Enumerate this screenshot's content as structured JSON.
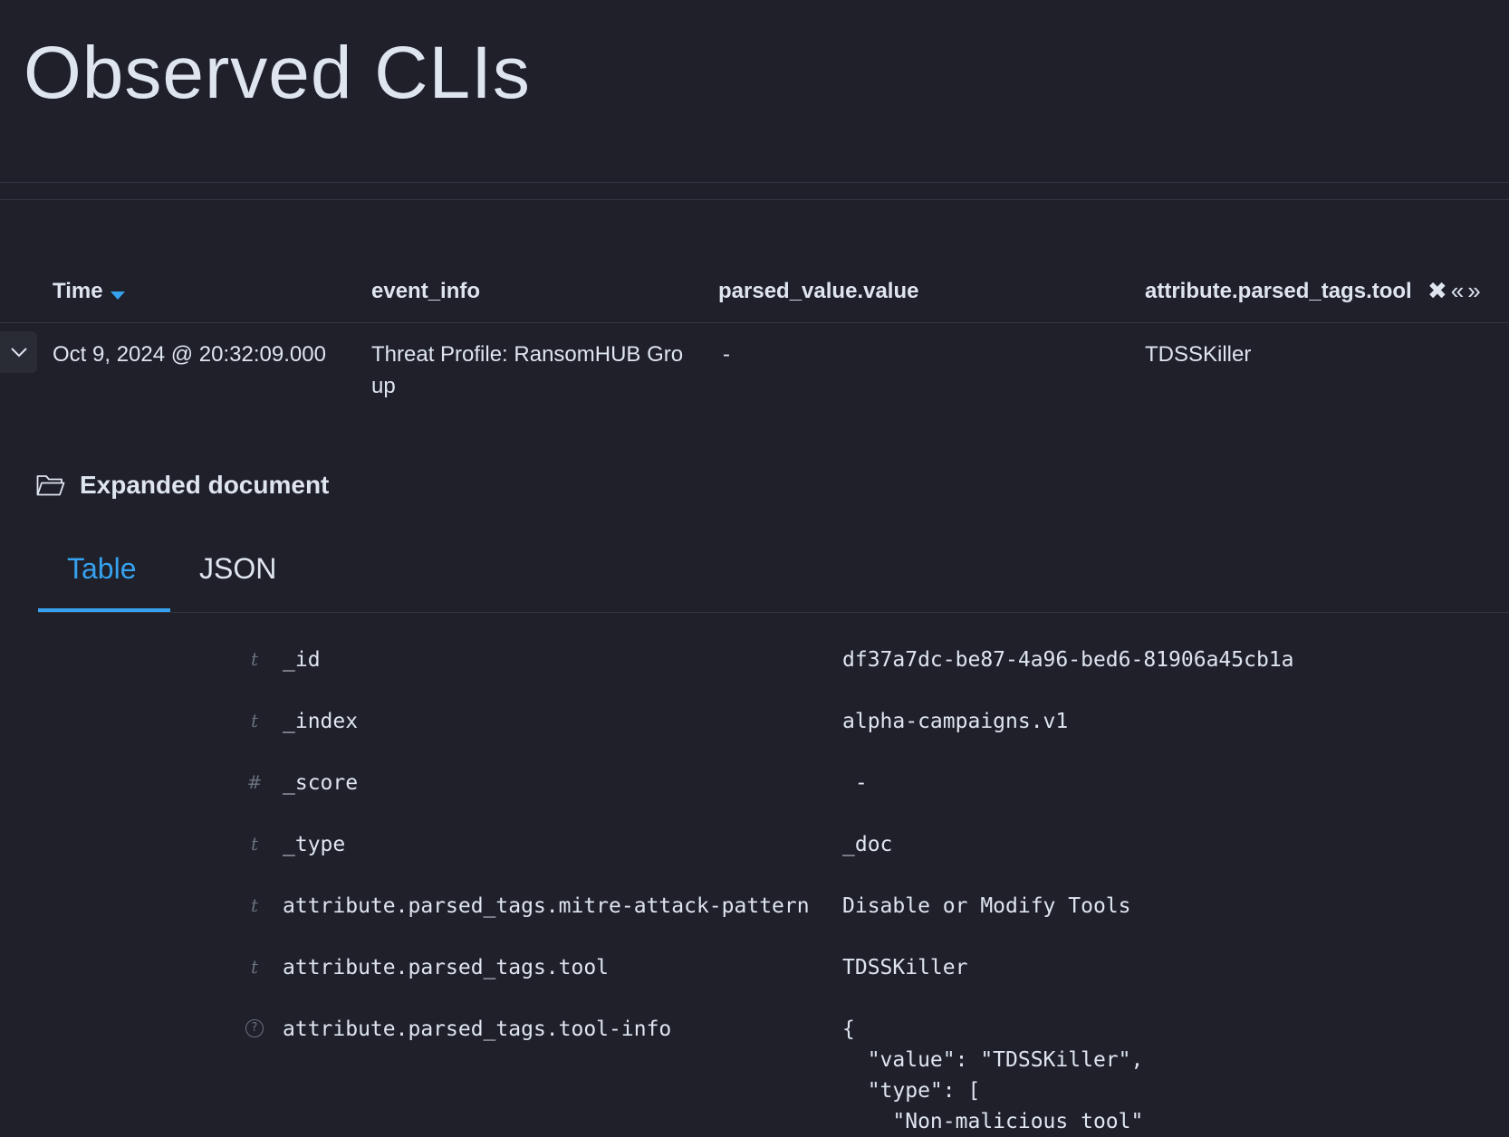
{
  "page": {
    "title": "Observed CLIs"
  },
  "table": {
    "columns": [
      {
        "label": "Time",
        "sorted": "desc"
      },
      {
        "label": "event_info"
      },
      {
        "label": "parsed_value.value"
      },
      {
        "label": "attribute.parsed_tags.tool"
      }
    ],
    "header_icons": {
      "remove": "✖",
      "move_left": "«",
      "move_right": "»"
    },
    "row": {
      "time": "Oct 9, 2024 @ 20:32:09.000",
      "event_info": "Threat Profile: RansomHUB Group",
      "parsed_value": "-",
      "tool": "TDSSKiller"
    }
  },
  "expanded": {
    "heading": "Expanded document",
    "tabs": [
      {
        "label": "Table",
        "active": true
      },
      {
        "label": "JSON",
        "active": false
      }
    ],
    "fields": [
      {
        "type_icon": "t",
        "name": "_id",
        "value": "df37a7dc-be87-4a96-bed6-81906a45cb1a"
      },
      {
        "type_icon": "t",
        "name": "_index",
        "value": "alpha-campaigns.v1"
      },
      {
        "type_icon": "#",
        "name": "_score",
        "value": " -"
      },
      {
        "type_icon": "t",
        "name": "_type",
        "value": "_doc"
      },
      {
        "type_icon": "t",
        "name": "attribute.parsed_tags.mitre-attack-pattern",
        "value": "Disable or Modify Tools"
      },
      {
        "type_icon": "t",
        "name": "attribute.parsed_tags.tool",
        "value": "TDSSKiller"
      },
      {
        "type_icon": "?",
        "name": "attribute.parsed_tags.tool-info",
        "value": "{\n  \"value\": \"TDSSKiller\",\n  \"type\": [\n    \"Non-malicious tool\""
      }
    ]
  },
  "colors": {
    "background": "#1f2029",
    "accent": "#36a2ef",
    "text": "#dfe5ef",
    "muted": "#6a717d"
  }
}
